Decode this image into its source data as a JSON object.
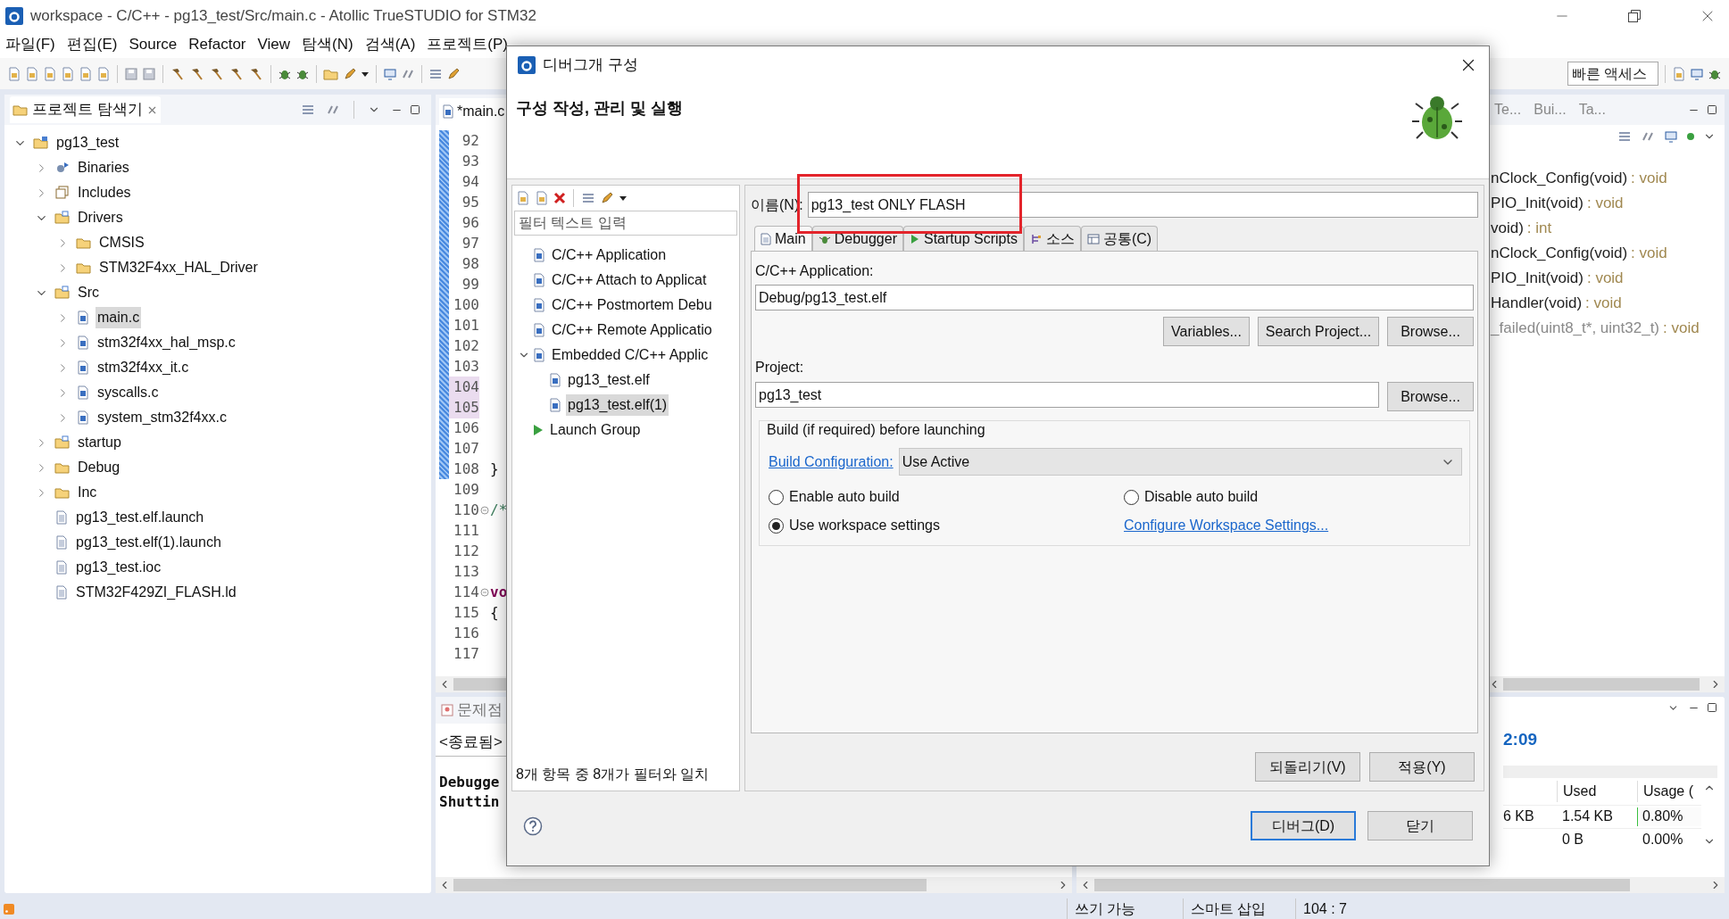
{
  "window": {
    "title": "workspace - C/C++ - pg13_test/Src/main.c - Atollic TrueSTUDIO for STM32"
  },
  "menu": [
    "파일(F)",
    "편집(E)",
    "Source",
    "Refactor",
    "View",
    "탐색(N)",
    "검색(A)",
    "프로젝트(P)"
  ],
  "quick_access": {
    "placeholder": "빠른 액세스"
  },
  "project_explorer": {
    "title": "프로젝트 탐색기",
    "tree": [
      {
        "label": "pg13_test",
        "kind": "project",
        "expanded": true,
        "selected": false,
        "children": [
          {
            "label": "Binaries",
            "kind": "binaries",
            "expanded": false,
            "selected": false
          },
          {
            "label": "Includes",
            "kind": "includes",
            "expanded": false,
            "selected": false
          },
          {
            "label": "Drivers",
            "kind": "source-folder",
            "expanded": true,
            "selected": false,
            "children": [
              {
                "label": "CMSIS",
                "kind": "folder",
                "expanded": false,
                "selected": false
              },
              {
                "label": "STM32F4xx_HAL_Driver",
                "kind": "folder",
                "expanded": false,
                "selected": false
              }
            ]
          },
          {
            "label": "Src",
            "kind": "source-folder",
            "expanded": true,
            "selected": false,
            "children": [
              {
                "label": "main.c",
                "kind": "c-file",
                "expanded": false,
                "selected": true
              },
              {
                "label": "stm32f4xx_hal_msp.c",
                "kind": "c-file",
                "expanded": false,
                "selected": false
              },
              {
                "label": "stm32f4xx_it.c",
                "kind": "c-file",
                "expanded": false,
                "selected": false
              },
              {
                "label": "syscalls.c",
                "kind": "c-file",
                "expanded": false,
                "selected": false
              },
              {
                "label": "system_stm32f4xx.c",
                "kind": "c-file",
                "expanded": false,
                "selected": false
              }
            ]
          },
          {
            "label": "startup",
            "kind": "source-folder",
            "expanded": false,
            "selected": false
          },
          {
            "label": "Debug",
            "kind": "folder",
            "expanded": false,
            "selected": false
          },
          {
            "label": "Inc",
            "kind": "folder",
            "expanded": false,
            "selected": false
          },
          {
            "label": "pg13_test.elf.launch",
            "kind": "file",
            "selected": false
          },
          {
            "label": "pg13_test.elf(1).launch",
            "kind": "file",
            "selected": false
          },
          {
            "label": "pg13_test.ioc",
            "kind": "file",
            "selected": false
          },
          {
            "label": "STM32F429ZI_FLASH.ld",
            "kind": "file",
            "selected": false
          }
        ]
      }
    ]
  },
  "editor": {
    "tab": "*main.c",
    "lines": [
      {
        "number": "92",
        "changed": true,
        "highlighted": false,
        "fold": false
      },
      {
        "number": "93",
        "changed": true,
        "highlighted": false,
        "fold": false
      },
      {
        "number": "94",
        "changed": true,
        "highlighted": false,
        "fold": false
      },
      {
        "number": "95",
        "changed": true,
        "highlighted": false,
        "fold": false
      },
      {
        "number": "96",
        "changed": true,
        "highlighted": false,
        "fold": false
      },
      {
        "number": "97",
        "changed": true,
        "highlighted": false,
        "fold": false
      },
      {
        "number": "98",
        "changed": true,
        "highlighted": false,
        "fold": false
      },
      {
        "number": "99",
        "changed": true,
        "highlighted": false,
        "fold": false
      },
      {
        "number": "100",
        "changed": true,
        "highlighted": false,
        "fold": false
      },
      {
        "number": "101",
        "changed": true,
        "highlighted": false,
        "fold": false
      },
      {
        "number": "102",
        "changed": true,
        "highlighted": false,
        "fold": false
      },
      {
        "number": "103",
        "changed": true,
        "highlighted": false,
        "fold": false
      },
      {
        "number": "104",
        "changed": true,
        "highlighted": true,
        "fold": false
      },
      {
        "number": "105",
        "changed": true,
        "highlighted": true,
        "fold": false
      },
      {
        "number": "106",
        "changed": true,
        "highlighted": false,
        "fold": false
      },
      {
        "number": "107",
        "changed": true,
        "highlighted": false,
        "fold": false
      },
      {
        "number": "108",
        "changed": true,
        "highlighted": false,
        "fold": false,
        "code": {
          "text": "}",
          "kind": "plain"
        }
      },
      {
        "number": "109",
        "changed": false,
        "highlighted": false,
        "fold": false
      },
      {
        "number": "110",
        "changed": false,
        "highlighted": false,
        "fold": true,
        "code": {
          "text": "/*",
          "kind": "comment"
        }
      },
      {
        "number": "111",
        "changed": false,
        "highlighted": false,
        "fold": false
      },
      {
        "number": "112",
        "changed": false,
        "highlighted": false,
        "fold": false
      },
      {
        "number": "113",
        "changed": false,
        "highlighted": false,
        "fold": false
      },
      {
        "number": "114",
        "changed": false,
        "highlighted": false,
        "fold": true,
        "code": {
          "text": "vo",
          "kind": "keyword"
        }
      },
      {
        "number": "115",
        "changed": false,
        "highlighted": false,
        "fold": false,
        "code": {
          "text": "{",
          "kind": "plain"
        }
      },
      {
        "number": "116",
        "changed": false,
        "highlighted": false,
        "fold": false
      },
      {
        "number": "117",
        "changed": false,
        "highlighted": false,
        "fold": false
      }
    ]
  },
  "console": {
    "tab": "문제점",
    "status": "<종료됨>",
    "lines": [
      "Debugge",
      "Shuttin"
    ]
  },
  "outline": {
    "tabs": [
      "Te...",
      "Bui...",
      "Ta..."
    ],
    "items": [
      {
        "name": "nClock_Config(void)",
        "type": ": void",
        "dimmed": false
      },
      {
        "name": "PIO_Init(void)",
        "type": ": void",
        "dimmed": false
      },
      {
        "name": "void)",
        "type": ": int",
        "dimmed": false
      },
      {
        "name": "nClock_Config(void)",
        "type": ": void",
        "dimmed": false
      },
      {
        "name": "PIO_Init(void)",
        "type": ": void",
        "dimmed": false
      },
      {
        "name": "Handler(void)",
        "type": ": void",
        "dimmed": false
      },
      {
        "name": "_failed(uint8_t*, uint32_t)",
        "type": ": void",
        "dimmed": true
      }
    ]
  },
  "memory": {
    "time": "2:09",
    "columns": [
      "Used",
      "Usage ("
    ],
    "rows": [
      {
        "size": "6 KB",
        "used": "1.54 KB",
        "usage": "0.80%",
        "level": 0.008
      },
      {
        "used": "0 B",
        "usage": "0.00%"
      }
    ]
  },
  "status_bar": [
    "쓰기 가능",
    "스마트 삽입",
    "104 : 7"
  ],
  "dialog": {
    "title": "디버그개 구성",
    "heading": "구성 작성, 관리 및 실행",
    "filter": {
      "placeholder": "필터 텍스트 입력"
    },
    "config_tree": [
      {
        "label": "C/C++ Application",
        "kind": "type",
        "selected": false
      },
      {
        "label": "C/C++ Attach to Applicat",
        "kind": "type",
        "selected": false
      },
      {
        "label": "C/C++ Postmortem Debu",
        "kind": "type",
        "selected": false
      },
      {
        "label": "C/C++ Remote Applicatio",
        "kind": "type",
        "selected": false
      },
      {
        "label": "Embedded C/C++ Applic",
        "kind": "type",
        "expanded": true,
        "selected": false,
        "children": [
          {
            "label": "pg13_test.elf",
            "kind": "config",
            "selected": false
          },
          {
            "label": "pg13_test.elf(1)",
            "kind": "config",
            "selected": true
          }
        ]
      },
      {
        "label": "Launch Group",
        "kind": "group",
        "selected": false
      }
    ],
    "filter_status": "8개 항목 중 8개가 필터와 일치",
    "name": {
      "label": "이름(N):",
      "value": "pg13_test ONLY FLASH"
    },
    "tabs": [
      {
        "label": "Main",
        "kind": "main",
        "selected": true
      },
      {
        "label": "Debugger",
        "kind": "debugger",
        "selected": false
      },
      {
        "label": "Startup Scripts",
        "kind": "scripts",
        "selected": false
      },
      {
        "label": "소스",
        "kind": "source",
        "selected": false
      },
      {
        "label": "공통(C)",
        "kind": "common",
        "selected": false
      }
    ],
    "application": {
      "label": "C/C++ Application:",
      "value": "Debug/pg13_test.elf",
      "buttons": [
        "Variables...",
        "Search Project...",
        "Browse..."
      ]
    },
    "project": {
      "label": "Project:",
      "value": "pg13_test",
      "button": "Browse..."
    },
    "build": {
      "title": "Build (if required) before launching",
      "config_link": "Build Configuration:",
      "config_value": "Use Active",
      "options": [
        {
          "label": "Enable auto build",
          "selected": false
        },
        {
          "label": "Disable auto build",
          "selected": false
        },
        {
          "label": "Use workspace settings",
          "selected": true
        }
      ],
      "workspace_link": "Configure Workspace Settings..."
    },
    "revert_button": "되돌리기(V)",
    "apply_button": "적용(Y)",
    "debug_button": "디버그(D)",
    "close_button": "닫기"
  }
}
